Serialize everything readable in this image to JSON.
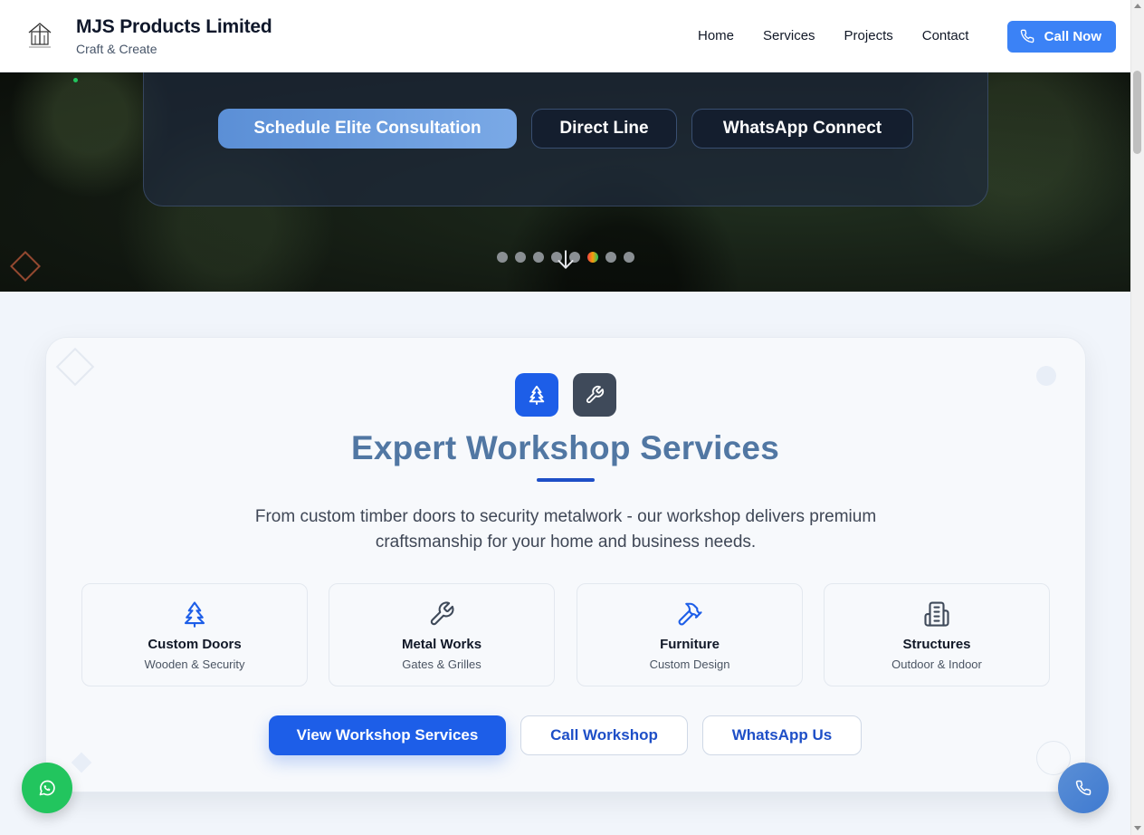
{
  "header": {
    "brand_name": "MJS Products Limited",
    "tagline": "Craft & Create",
    "nav": [
      "Home",
      "Services",
      "Projects",
      "Contact"
    ],
    "call_label": "Call Now",
    "accent": "#3b82f6"
  },
  "hero": {
    "buttons": {
      "primary": "Schedule Elite Consultation",
      "direct": "Direct Line",
      "whatsapp": "WhatsApp Connect"
    },
    "slides_total": 8,
    "active_slide": 6
  },
  "services": {
    "title": "Expert Workshop Services",
    "description": "From custom timber doors to security metalwork - our workshop delivers premium craftsmanship for your home and business needs.",
    "features": [
      {
        "title": "Custom Doors",
        "subtitle": "Wooden & Security",
        "icon": "tree-icon"
      },
      {
        "title": "Metal Works",
        "subtitle": "Gates & Grilles",
        "icon": "wrench-icon"
      },
      {
        "title": "Furniture",
        "subtitle": "Custom Design",
        "icon": "hammer-icon"
      },
      {
        "title": "Structures",
        "subtitle": "Outdoor & Indoor",
        "icon": "building-icon"
      }
    ],
    "cta": {
      "primary": "View Workshop Services",
      "call": "Call Workshop",
      "whatsapp": "WhatsApp Us"
    },
    "accent": "#1d5ee8"
  },
  "floating": {
    "whatsapp_color": "#22c55e",
    "phone_color": "#4a86d4"
  }
}
